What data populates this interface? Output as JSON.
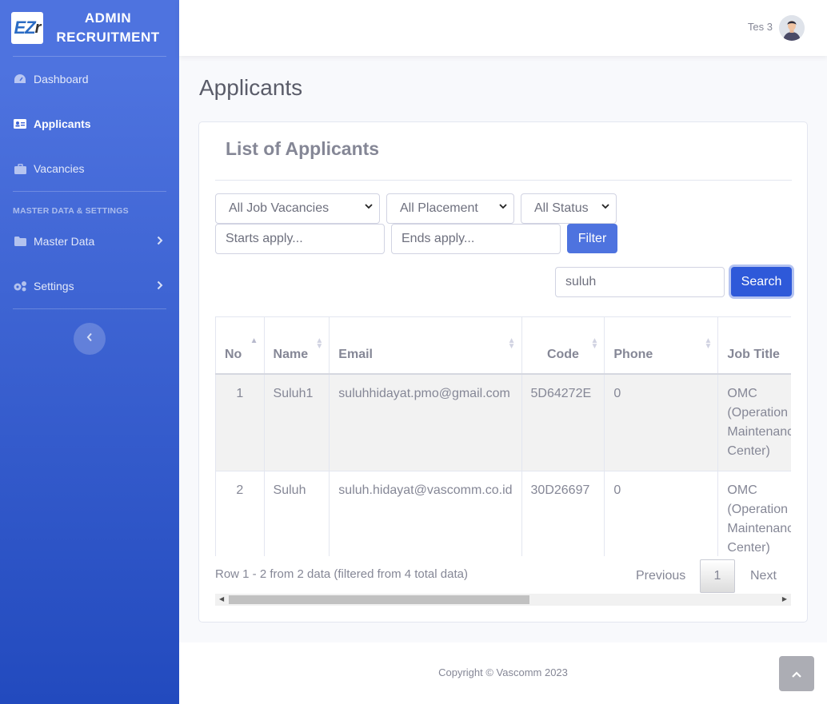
{
  "brand": {
    "logo_text": "EZr",
    "title": "ADMIN RECRUITMENT"
  },
  "sidebar": {
    "items": [
      {
        "label": "Dashboard",
        "icon": "dashboard-icon"
      },
      {
        "label": "Applicants",
        "icon": "id-card-icon",
        "active": true
      },
      {
        "label": "Vacancies",
        "icon": "briefcase-icon"
      }
    ],
    "heading": "MASTER DATA & SETTINGS",
    "sub_items": [
      {
        "label": "Master Data",
        "icon": "folder-icon"
      },
      {
        "label": "Settings",
        "icon": "cogs-icon"
      }
    ]
  },
  "topbar": {
    "user_name": "Tes 3"
  },
  "page": {
    "title": "Applicants"
  },
  "card": {
    "title": "List of Applicants"
  },
  "filters": {
    "job_vacancy": "All Job Vacancies",
    "placement": "All Placement",
    "status": "All Status",
    "starts_placeholder": "Starts apply...",
    "ends_placeholder": "Ends apply...",
    "filter_label": "Filter",
    "search_value": "suluh",
    "search_label": "Search"
  },
  "table": {
    "headers": [
      "No",
      "Name",
      "Email",
      "Code",
      "Phone",
      "Job Title"
    ],
    "rows": [
      {
        "no": "1",
        "name": "Suluh1",
        "email": "suluhhidayat.pmo@gmail.com",
        "code": "5D64272E",
        "phone": "0",
        "job_title": "OMC (Operation Maintenance Center)"
      },
      {
        "no": "2",
        "name": "Suluh",
        "email": "suluh.hidayat@vascomm.co.id",
        "code": "30D26697",
        "phone": "0",
        "job_title": "OMC (Operation Maintenance Center)"
      }
    ]
  },
  "pagination": {
    "info": "Row 1 - 2 from 2 data (filtered from 4 total data)",
    "previous": "Previous",
    "current": "1",
    "next": "Next"
  },
  "footer": {
    "copyright": "Copyright © Vascomm 2023"
  },
  "colors": {
    "primary": "#4e73df",
    "sidebar_end": "#224abe",
    "text": "#858796"
  }
}
